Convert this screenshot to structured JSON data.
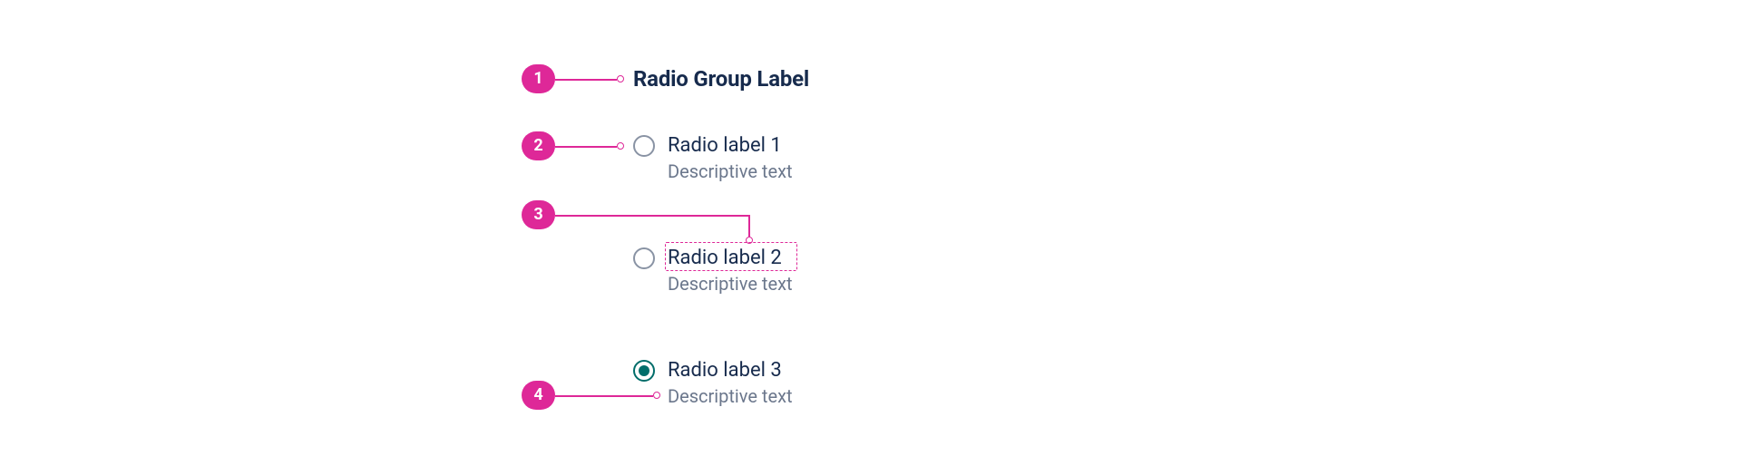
{
  "annotations": {
    "a1": "1",
    "a2": "2",
    "a3": "3",
    "a4": "4"
  },
  "colors": {
    "accent_pink": "#DE2898",
    "accent_teal": "#006D6A",
    "text_primary": "#172B4D",
    "text_secondary": "#6B778C"
  },
  "group": {
    "label": "Radio Group Label",
    "options": [
      {
        "label": "Radio label 1",
        "description": "Descriptive text",
        "selected": false
      },
      {
        "label": "Radio label 2",
        "description": "Descriptive text",
        "selected": false
      },
      {
        "label": "Radio label 3",
        "description": "Descriptive text",
        "selected": true
      }
    ]
  }
}
